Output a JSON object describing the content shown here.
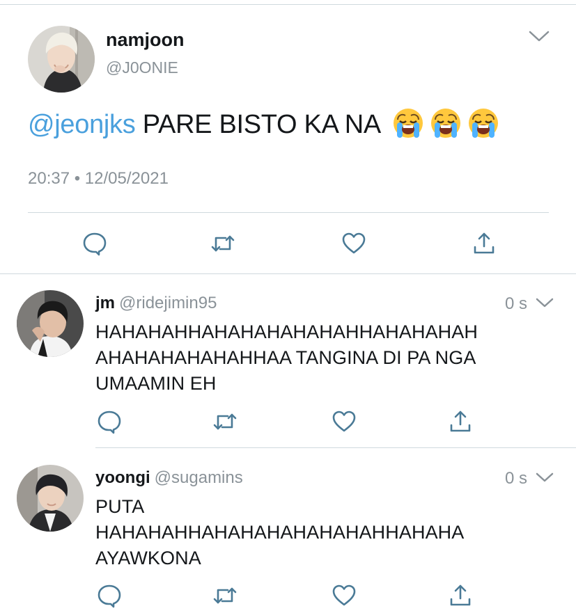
{
  "main_tweet": {
    "display_name": "namjoon",
    "handle": "@J0ONIE",
    "mention": "@jeonjks",
    "text": "PARE BISTO KA NA",
    "emojis": [
      "loudly-crying-face",
      "loudly-crying-face",
      "loudly-crying-face"
    ],
    "timestamp": "20:37 • 12/05/2021"
  },
  "replies": [
    {
      "display_name": "jm",
      "handle": "@ridejimin95",
      "time": "0 s",
      "text": "HAHAHAHHAHAHAHAHAHAHHAHAHAHAH\nAHAHAHAHAHAHHAA TANGINA DI PA NGA\nUMAAMIN EH"
    },
    {
      "display_name": "yoongi",
      "handle": "@sugamins",
      "time": "0 s",
      "text": "PUTA\nHAHAHAHHAHAHAHAHAHAHAHHAHAHA\nAYAWKONA"
    }
  ],
  "colors": {
    "mention": "#4aa0dd",
    "secondary_text": "#8a9298",
    "icon": "#4a7a96",
    "divider": "#cfd9de"
  }
}
